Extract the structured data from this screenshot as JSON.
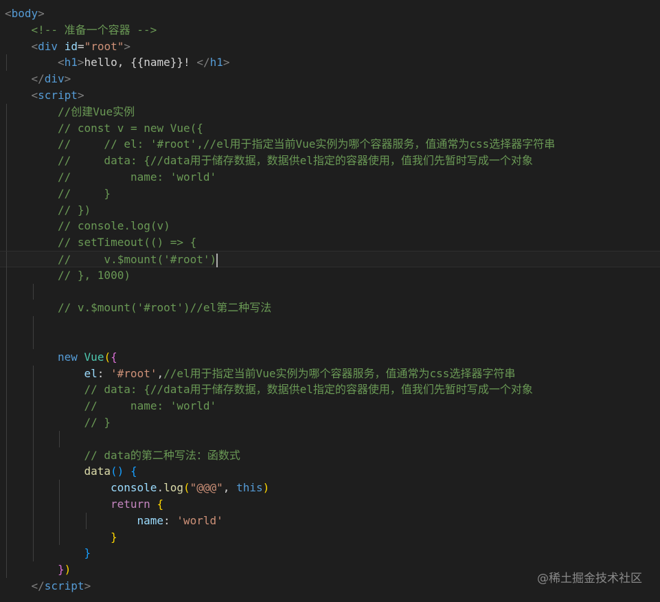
{
  "editor": {
    "theme": "dark",
    "background": "#1e1e1e",
    "cursor_line": 16,
    "lines": [
      {
        "n": 1,
        "indent": 0,
        "tokens": [
          [
            "tag-bracket",
            "<"
          ],
          [
            "tag",
            "body"
          ],
          [
            "tag-bracket",
            ">"
          ]
        ]
      },
      {
        "n": 2,
        "indent": 1,
        "tokens": [
          [
            "cmt",
            "<!-- 准备一个容器 -->"
          ]
        ]
      },
      {
        "n": 3,
        "indent": 1,
        "tokens": [
          [
            "tag-bracket",
            "<"
          ],
          [
            "tag",
            "div"
          ],
          [
            "txt",
            " "
          ],
          [
            "attr",
            "id"
          ],
          [
            "txt",
            "="
          ],
          [
            "str",
            "\"root\""
          ],
          [
            "tag-bracket",
            ">"
          ]
        ]
      },
      {
        "n": 4,
        "indent": 2,
        "tokens": [
          [
            "tag-bracket",
            "<"
          ],
          [
            "tag",
            "h1"
          ],
          [
            "tag-bracket",
            ">"
          ],
          [
            "txt",
            "hello, {{name}}! "
          ],
          [
            "tag-bracket",
            "</"
          ],
          [
            "tag",
            "h1"
          ],
          [
            "tag-bracket",
            ">"
          ]
        ]
      },
      {
        "n": 5,
        "indent": 1,
        "tokens": [
          [
            "tag-bracket",
            "</"
          ],
          [
            "tag",
            "div"
          ],
          [
            "tag-bracket",
            ">"
          ]
        ]
      },
      {
        "n": 6,
        "indent": 1,
        "tokens": [
          [
            "tag-bracket",
            "<"
          ],
          [
            "tag",
            "script"
          ],
          [
            "tag-bracket",
            ">"
          ]
        ]
      },
      {
        "n": 7,
        "indent": 2,
        "tokens": [
          [
            "cmt",
            "//创建Vue实例"
          ]
        ]
      },
      {
        "n": 8,
        "indent": 2,
        "tokens": [
          [
            "cmt",
            "// const v = new Vue({"
          ]
        ]
      },
      {
        "n": 9,
        "indent": 2,
        "tokens": [
          [
            "cmt",
            "//     // el: '#root',//el用于指定当前Vue实例为哪个容器服务，值通常为css选择器字符串"
          ]
        ]
      },
      {
        "n": 10,
        "indent": 2,
        "tokens": [
          [
            "cmt",
            "//     data: {//data用于储存数据，数据供el指定的容器使用，值我们先暂时写成一个对象"
          ]
        ]
      },
      {
        "n": 11,
        "indent": 2,
        "tokens": [
          [
            "cmt",
            "//         name: 'world'"
          ]
        ]
      },
      {
        "n": 12,
        "indent": 2,
        "tokens": [
          [
            "cmt",
            "//     }"
          ]
        ]
      },
      {
        "n": 13,
        "indent": 2,
        "tokens": [
          [
            "cmt",
            "// })"
          ]
        ]
      },
      {
        "n": 14,
        "indent": 2,
        "tokens": [
          [
            "cmt",
            "// console.log(v)"
          ]
        ]
      },
      {
        "n": 15,
        "indent": 2,
        "tokens": [
          [
            "cmt",
            "// setTimeout(() => {"
          ]
        ]
      },
      {
        "n": 16,
        "indent": 2,
        "tokens": [
          [
            "cmt",
            "//     v.$mount('#root')"
          ],
          [
            "cursor",
            ""
          ]
        ]
      },
      {
        "n": 17,
        "indent": 2,
        "tokens": [
          [
            "cmt",
            "// }, 1000)"
          ]
        ]
      },
      {
        "n": 18,
        "indent": 2,
        "tokens": []
      },
      {
        "n": 19,
        "indent": 2,
        "tokens": [
          [
            "cmt",
            "// v.$mount('#root')//el第二种写法"
          ]
        ]
      },
      {
        "n": 20,
        "indent": 2,
        "tokens": []
      },
      {
        "n": 21,
        "indent": 2,
        "tokens": []
      },
      {
        "n": 22,
        "indent": 2,
        "tokens": [
          [
            "kw",
            "new"
          ],
          [
            "txt",
            " "
          ],
          [
            "cls",
            "Vue"
          ],
          [
            "br1",
            "("
          ],
          [
            "br2",
            "{"
          ]
        ]
      },
      {
        "n": 23,
        "indent": 3,
        "tokens": [
          [
            "var",
            "el"
          ],
          [
            "txt",
            ": "
          ],
          [
            "str",
            "'#root'"
          ],
          [
            "txt",
            ","
          ],
          [
            "cmt",
            "//el用于指定当前Vue实例为哪个容器服务，值通常为css选择器字符串"
          ]
        ]
      },
      {
        "n": 24,
        "indent": 3,
        "tokens": [
          [
            "cmt",
            "// data: {//data用于储存数据，数据供el指定的容器使用，值我们先暂时写成一个对象"
          ]
        ]
      },
      {
        "n": 25,
        "indent": 3,
        "tokens": [
          [
            "cmt",
            "//     name: 'world'"
          ]
        ]
      },
      {
        "n": 26,
        "indent": 3,
        "tokens": [
          [
            "cmt",
            "// }"
          ]
        ]
      },
      {
        "n": 27,
        "indent": 3,
        "tokens": []
      },
      {
        "n": 28,
        "indent": 3,
        "tokens": [
          [
            "cmt",
            "// data的第二种写法：函数式"
          ]
        ]
      },
      {
        "n": 29,
        "indent": 3,
        "tokens": [
          [
            "fn",
            "data"
          ],
          [
            "br3",
            "()"
          ],
          [
            "txt",
            " "
          ],
          [
            "br3",
            "{"
          ]
        ]
      },
      {
        "n": 30,
        "indent": 4,
        "tokens": [
          [
            "var",
            "console"
          ],
          [
            "txt",
            "."
          ],
          [
            "fn",
            "log"
          ],
          [
            "br1",
            "("
          ],
          [
            "str",
            "\"@@@\""
          ],
          [
            "txt",
            ", "
          ],
          [
            "kw",
            "this"
          ],
          [
            "br1",
            ")"
          ]
        ]
      },
      {
        "n": 31,
        "indent": 4,
        "tokens": [
          [
            "ctl",
            "return"
          ],
          [
            "txt",
            " "
          ],
          [
            "br1",
            "{"
          ]
        ]
      },
      {
        "n": 32,
        "indent": 5,
        "tokens": [
          [
            "var",
            "name"
          ],
          [
            "txt",
            ": "
          ],
          [
            "str",
            "'world'"
          ]
        ]
      },
      {
        "n": 33,
        "indent": 4,
        "tokens": [
          [
            "br1",
            "}"
          ]
        ]
      },
      {
        "n": 34,
        "indent": 3,
        "tokens": [
          [
            "br3",
            "}"
          ]
        ]
      },
      {
        "n": 35,
        "indent": 2,
        "tokens": [
          [
            "br2",
            "}"
          ],
          [
            "br1",
            ")"
          ]
        ]
      },
      {
        "n": 36,
        "indent": 1,
        "tokens": [
          [
            "tag-bracket",
            "</"
          ],
          [
            "tag",
            "script"
          ],
          [
            "tag-bracket",
            ">"
          ]
        ]
      }
    ]
  },
  "watermark": "@稀土掘金技术社区"
}
